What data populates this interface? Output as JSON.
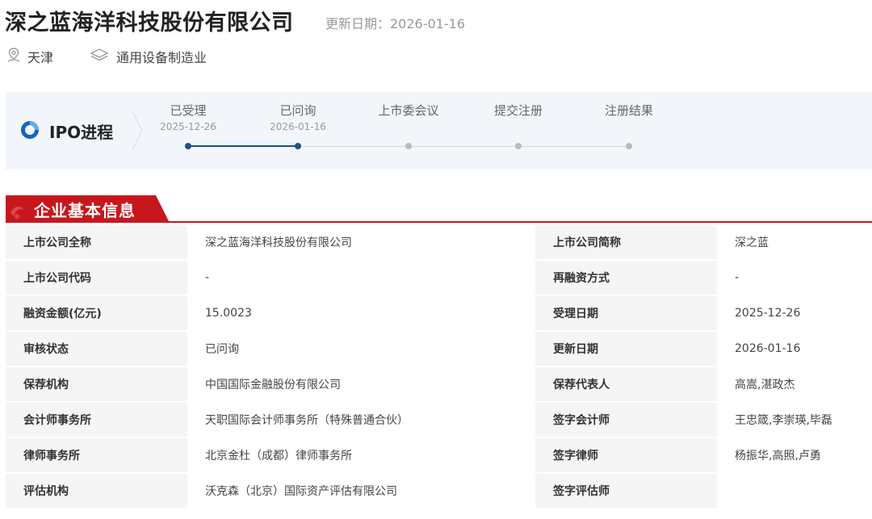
{
  "header": {
    "company_name": "深之蓝海洋科技股份有限公司",
    "update_date": "更新日期：2026-01-16",
    "location": "天津",
    "industry": "通用设备制造业",
    "icons": [
      "location-pin-icon",
      "layers-icon"
    ]
  },
  "ipo": {
    "title": "IPO进程",
    "steps": [
      {
        "name": "已受理",
        "date": "2025-12-26",
        "done": true
      },
      {
        "name": "已问询",
        "date": "2026-01-16",
        "done": true
      },
      {
        "name": "上市委会议",
        "date": "",
        "done": false
      },
      {
        "name": "提交注册",
        "date": "",
        "done": false
      },
      {
        "name": "注册结果",
        "date": "",
        "done": false
      }
    ],
    "colors": {
      "active": "#1f4e8c",
      "inactive": "#bbbbbb",
      "logo": "#1565c0"
    }
  },
  "section": {
    "title": "企业基本信息",
    "accent": "#c8161d"
  },
  "info": {
    "rows": [
      {
        "label1": "上市公司全称",
        "value1": "深之蓝海洋科技股份有限公司",
        "label2": "上市公司简称",
        "value2": "深之蓝"
      },
      {
        "label1": "上市公司代码",
        "value1": "-",
        "label2": "再融资方式",
        "value2": "-"
      },
      {
        "label1": "融资金额(亿元)",
        "value1": "15.0023",
        "label2": "受理日期",
        "value2": "2025-12-26"
      },
      {
        "label1": "审核状态",
        "value1": "已问询",
        "label2": "更新日期",
        "value2": "2026-01-16"
      },
      {
        "label1": "保荐机构",
        "value1": "中国国际金融股份有限公司",
        "label2": "保荐代表人",
        "value2": "高嵩,湛政杰"
      },
      {
        "label1": "会计师事务所",
        "value1": "天职国际会计师事务所（特殊普通合伙）",
        "label2": "签字会计师",
        "value2": "王忠箴,李崇瑛,毕磊"
      },
      {
        "label1": "律师事务所",
        "value1": "北京金杜（成都）律师事务所",
        "label2": "签字律师",
        "value2": "杨振华,高照,卢勇"
      },
      {
        "label1": "评估机构",
        "value1": "沃克森（北京）国际资产评估有限公司",
        "label2": "签字评估师",
        "value2": ""
      }
    ]
  }
}
